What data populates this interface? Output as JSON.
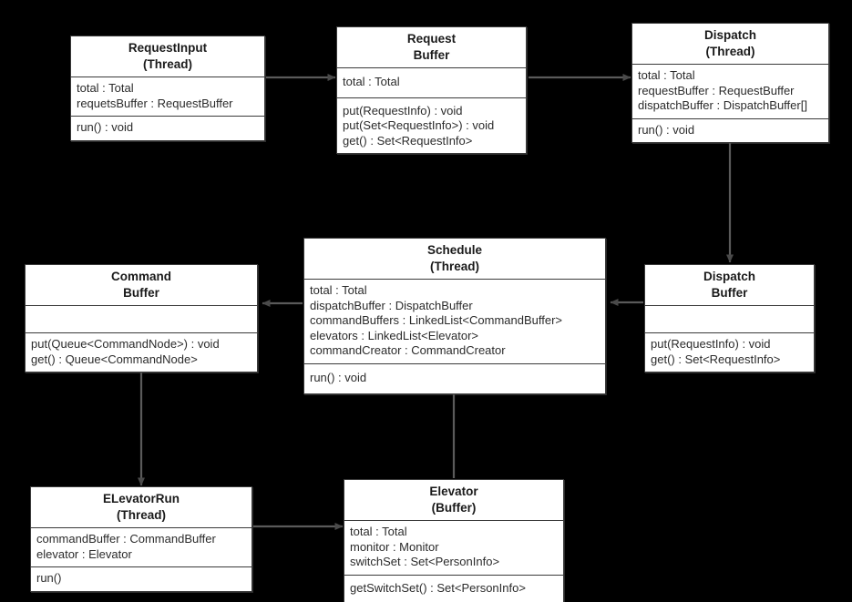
{
  "diagram": {
    "title": "Elevator System UML Class Diagram",
    "background_color": "#000000",
    "box_fill_color": "#ffffff",
    "line_color": "#5a5a5a"
  },
  "classes": [
    {
      "id": "request-input",
      "name": "RequestInput",
      "stereotype": "(Thread)",
      "attributes": [
        "total : Total",
        "requetsBuffer : RequestBuffer"
      ],
      "operations": [
        "run() : void"
      ]
    },
    {
      "id": "request-buffer",
      "name": "Request",
      "stereotype": "Buffer",
      "attributes": [
        "total : Total"
      ],
      "operations": [
        "put(RequestInfo) : void",
        "put(Set<RequestInfo>) : void",
        "get() : Set<RequestInfo>"
      ]
    },
    {
      "id": "dispatch",
      "name": "Dispatch",
      "stereotype": "(Thread)",
      "attributes": [
        "total : Total",
        "requestBuffer : RequestBuffer",
        "dispatchBuffer : DispatchBuffer[]"
      ],
      "operations": [
        "run() : void"
      ]
    },
    {
      "id": "dispatch-buffer",
      "name": "Dispatch",
      "stereotype": "Buffer",
      "attributes": [],
      "operations": [
        "put(RequestInfo) : void",
        "get() : Set<RequestInfo>"
      ]
    },
    {
      "id": "schedule",
      "name": "Schedule",
      "stereotype": "(Thread)",
      "attributes": [
        "total : Total",
        "dispatchBuffer : DispatchBuffer",
        "commandBuffers : LinkedList<CommandBuffer>",
        "elevators : LinkedList<Elevator>",
        "commandCreator : CommandCreator"
      ],
      "operations": [
        "run() : void"
      ]
    },
    {
      "id": "command-buffer",
      "name": "Command",
      "stereotype": "Buffer",
      "attributes": [],
      "operations": [
        "put(Queue<CommandNode>) : void",
        "get() : Queue<CommandNode>"
      ]
    },
    {
      "id": "elevator-run",
      "name": "ELevatorRun",
      "stereotype": "(Thread)",
      "attributes": [
        "commandBuffer : CommandBuffer",
        "elevator : Elevator"
      ],
      "operations": [
        "run()"
      ]
    },
    {
      "id": "elevator",
      "name": "Elevator",
      "stereotype": "(Buffer)",
      "attributes": [
        "total : Total",
        "monitor : Monitor",
        "switchSet : Set<PersonInfo>"
      ],
      "operations": [
        "getSwitchSet() : Set<PersonInfo>"
      ]
    }
  ],
  "connections": [
    {
      "from": "request-input",
      "to": "request-buffer",
      "direction": "right"
    },
    {
      "from": "request-buffer",
      "to": "dispatch",
      "direction": "right"
    },
    {
      "from": "dispatch",
      "to": "dispatch-buffer",
      "direction": "down"
    },
    {
      "from": "dispatch-buffer",
      "to": "schedule",
      "direction": "left"
    },
    {
      "from": "schedule",
      "to": "command-buffer",
      "direction": "left"
    },
    {
      "from": "command-buffer",
      "to": "elevator-run",
      "direction": "down"
    },
    {
      "from": "elevator-run",
      "to": "elevator",
      "direction": "right"
    },
    {
      "from": "elevator",
      "to": "schedule",
      "direction": "up"
    }
  ]
}
